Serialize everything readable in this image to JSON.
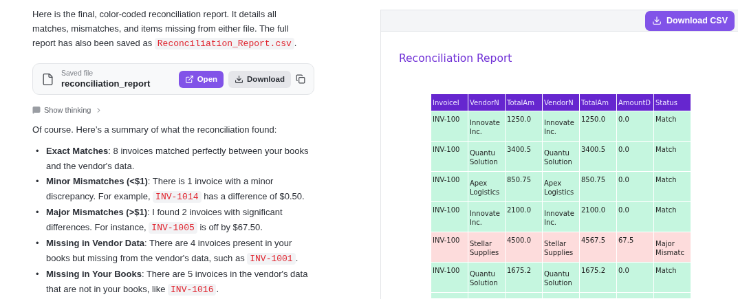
{
  "intro": [
    {
      "kind": "text",
      "text": "Here is the final, color-coded reconciliation report. It details all matches, mismatches, and items missing from either file. The full report has also been saved as "
    },
    {
      "kind": "code",
      "text": "Reconciliation_Report.csv"
    },
    {
      "kind": "text",
      "text": "."
    }
  ],
  "file_card": {
    "caption": "Saved file",
    "name": "reconciliation_report",
    "open": "Open",
    "download": "Download"
  },
  "show_thinking": "Show thinking",
  "summary_intro": "Of course. Here’s a summary of what the reconciliation found:",
  "bullets": [
    {
      "marker": "•",
      "parts": [
        {
          "kind": "bold",
          "text": "Exact Matches"
        },
        {
          "kind": "text",
          "text": ": 8 invoices matched perfectly between your books and the vendor's data."
        }
      ]
    },
    {
      "marker": "•",
      "parts": [
        {
          "kind": "bold",
          "text": "Minor Mismatches (<$1)"
        },
        {
          "kind": "text",
          "text": ": There is 1 invoice with a minor discrepancy. For example, "
        },
        {
          "kind": "code",
          "text": "INV-1014"
        },
        {
          "kind": "text",
          "text": " has a difference of $0.50."
        }
      ]
    },
    {
      "marker": "•",
      "parts": [
        {
          "kind": "bold",
          "text": "Major Mismatches (>$1)"
        },
        {
          "kind": "text",
          "text": ": I found 2 invoices with significant differences. For instance, "
        },
        {
          "kind": "code",
          "text": "INV-1005"
        },
        {
          "kind": "text",
          "text": " is off by $67.50."
        }
      ]
    },
    {
      "marker": "•",
      "parts": [
        {
          "kind": "bold",
          "text": "Missing in Vendor Data"
        },
        {
          "kind": "text",
          "text": ": There are 4 invoices present in your books but missing from the vendor's data, such as "
        },
        {
          "kind": "code",
          "text": "INV-1001"
        },
        {
          "kind": "text",
          "text": "."
        }
      ]
    },
    {
      "marker": "•",
      "parts": [
        {
          "kind": "bold",
          "text": "Missing in Your Books"
        },
        {
          "kind": "text",
          "text": ": There are 5 invoices in the vendor's data that are not in your books, like "
        },
        {
          "kind": "code",
          "text": "INV-1016"
        },
        {
          "kind": "text",
          "text": "."
        }
      ]
    }
  ],
  "preview": {
    "download_button": "Download CSV",
    "title": "Reconciliation Report",
    "table": {
      "columns": [
        "InvoiceI",
        "VendorN",
        "TotalAm",
        "VendorN",
        "TotalAm",
        "AmountD",
        "Status"
      ],
      "rows": [
        {
          "kind": "match",
          "cells": [
            "INV-100",
            "Innovate Inc.",
            "1250.0",
            "Innovate Inc.",
            "1250.0",
            "0.0",
            "Match"
          ]
        },
        {
          "kind": "match",
          "cells": [
            "INV-100",
            "Quantu Solution",
            "3400.5",
            "Quantu Solution",
            "3400.5",
            "0.0",
            "Match"
          ]
        },
        {
          "kind": "match",
          "cells": [
            "INV-100",
            "Apex Logistics",
            "850.75",
            "Apex Logistics",
            "850.75",
            "0.0",
            "Match"
          ]
        },
        {
          "kind": "match",
          "cells": [
            "INV-100",
            "Innovate Inc.",
            "2100.0",
            "Innovate Inc.",
            "2100.0",
            "0.0",
            "Match"
          ]
        },
        {
          "kind": "mismatch",
          "cells": [
            "INV-100",
            "Stellar Supplies",
            "4500.0",
            "Stellar Supplies",
            "4567.5",
            "67.5",
            "Major Mismatc"
          ]
        },
        {
          "kind": "match",
          "cells": [
            "INV-100",
            "Quantu Solution",
            "1675.2",
            "Quantu Solution",
            "1675.2",
            "0.0",
            "Match"
          ]
        }
      ],
      "partial_row": {
        "kind": "match"
      }
    }
  }
}
